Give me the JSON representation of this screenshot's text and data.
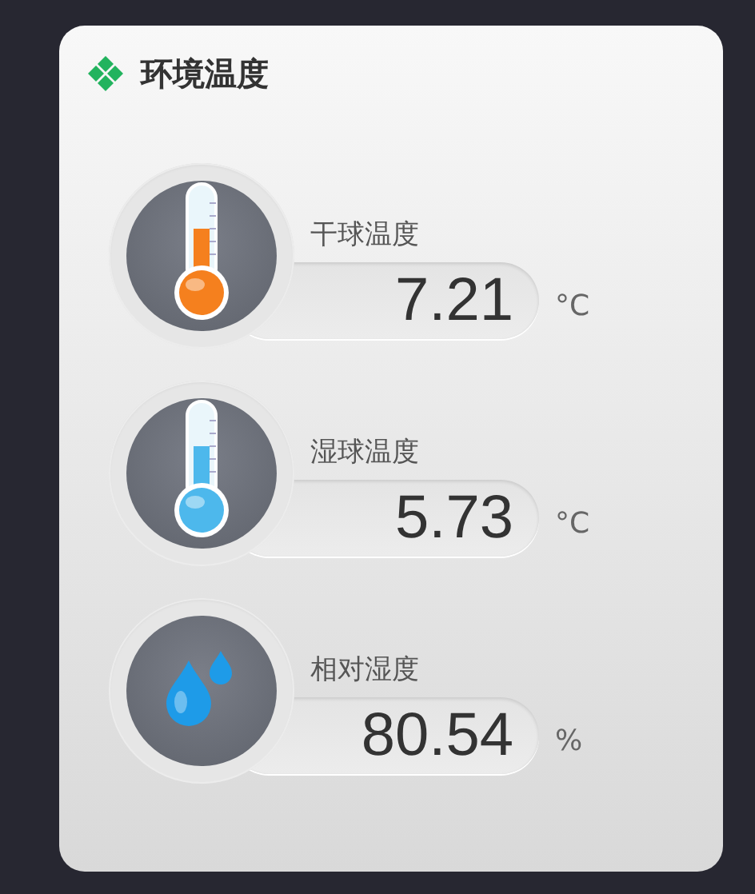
{
  "title": "环境温度",
  "sensors": [
    {
      "kind": "thermometer",
      "color": "#f5801e",
      "label": "干球温度",
      "value": "7.21",
      "unit": "°C"
    },
    {
      "kind": "thermometer",
      "color": "#4db8ec",
      "label": "湿球温度",
      "value": "5.73",
      "unit": "°C"
    },
    {
      "kind": "drops",
      "color": "#1e9be8",
      "label": "相对湿度",
      "value": "80.54",
      "unit": "%"
    }
  ]
}
